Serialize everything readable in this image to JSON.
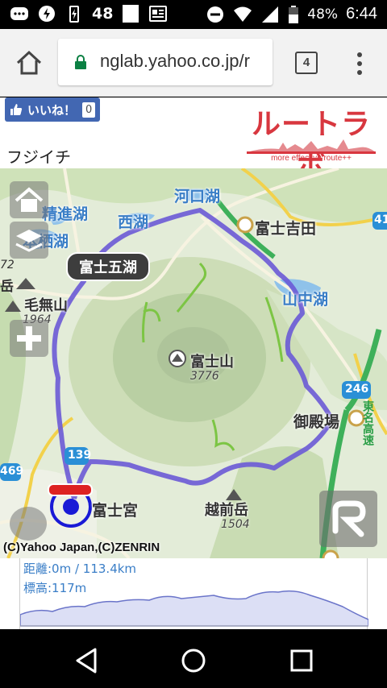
{
  "statusbar": {
    "notification_count": "48",
    "battery": "48%",
    "time": "6:44"
  },
  "browser": {
    "url": "nglab.yahoo.co.jp/r",
    "tab_count": "4"
  },
  "page": {
    "like_label": "いいね！",
    "like_count": "0",
    "brand_title": "ルートラボ",
    "brand_tagline": "more effective route++",
    "route_name": "フジイチ"
  },
  "map": {
    "region_label": "富士五湖",
    "lakes": {
      "kawaguchi": "河口湖",
      "shoji": "精進湖",
      "sai": "西湖",
      "motosu": "本栖湖",
      "yamanaka": "山中湖"
    },
    "towns": {
      "fujiyoshida": "富士吉田",
      "gotemba": "御殿場",
      "fujinomiya": "富士宮"
    },
    "peaks": {
      "fuji": "富士山",
      "fuji_elev": "3776",
      "kenashi": "毛無山",
      "kenashi_elev": "1964",
      "echizen": "越前岳",
      "echizen_elev": "1504"
    },
    "road_numbers": {
      "r246": "246",
      "r139": "139",
      "r469": "469",
      "r41": "41",
      "r72": "72"
    },
    "expressway": "東名高速",
    "edge_label": "岳",
    "copyright": "(C)Yahoo Japan,(C)ZENRIN"
  },
  "elevation_panel": {
    "distance": "距離:0m / 113.4km",
    "elevation": "標高:117m"
  },
  "colors": {
    "route": "#6a5ad6",
    "lake_text": "#3a7ec7",
    "brand": "#d8373f",
    "facebook": "#4267b2"
  }
}
